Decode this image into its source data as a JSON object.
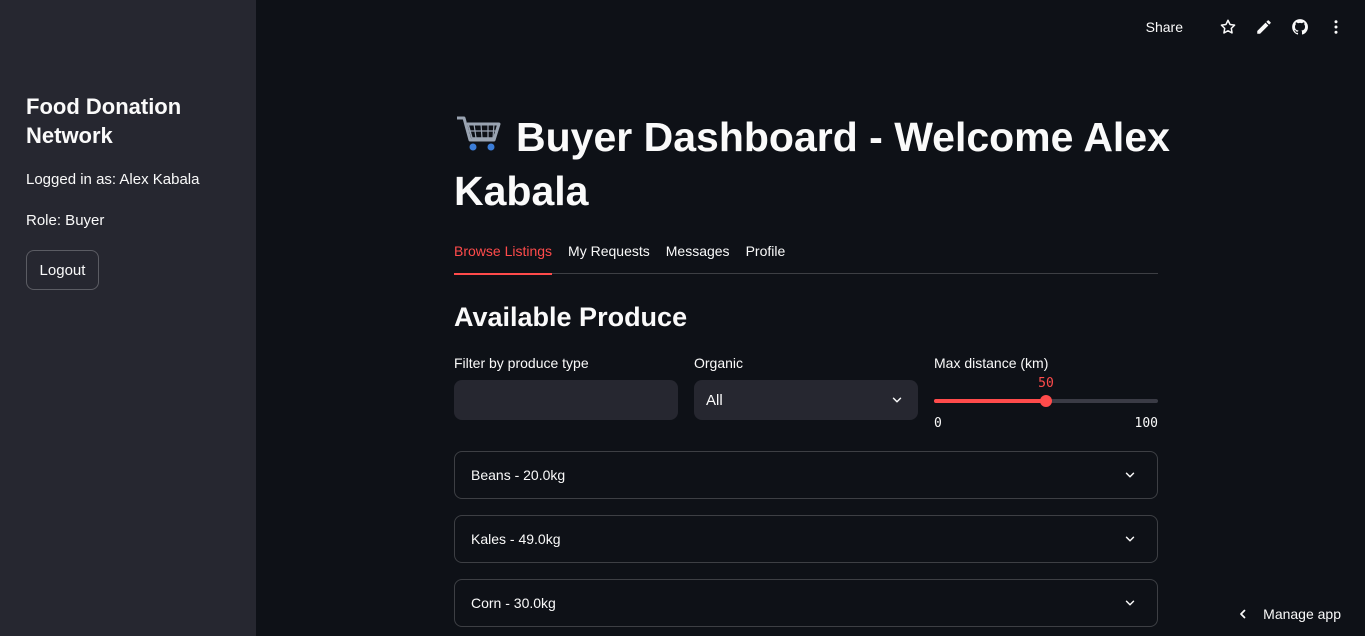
{
  "sidebar": {
    "title": "Food Donation Network",
    "logged_in": "Logged in as: Alex Kabala",
    "role": "Role: Buyer",
    "logout_label": "Logout"
  },
  "toolbar": {
    "share_label": "Share",
    "icons": [
      "star-icon",
      "pencil-icon",
      "github-icon",
      "more-vertical-icon"
    ]
  },
  "main": {
    "title_icon": "shopping-cart-icon",
    "title": "Buyer Dashboard - Welcome Alex Kabala",
    "tabs": [
      {
        "label": "Browse Listings",
        "active": true
      },
      {
        "label": "My Requests",
        "active": false
      },
      {
        "label": "Messages",
        "active": false
      },
      {
        "label": "Profile",
        "active": false
      }
    ],
    "section_title": "Available Produce",
    "filters": {
      "produce_label": "Filter by produce type",
      "produce_value": "",
      "organic_label": "Organic",
      "organic_value": "All",
      "distance_label": "Max distance (km)",
      "distance_value": "50",
      "distance_min": "0",
      "distance_max": "100",
      "distance_fraction": 0.5
    },
    "listings": [
      {
        "label": "Beans - 20.0kg"
      },
      {
        "label": "Kales - 49.0kg"
      },
      {
        "label": "Corn - 30.0kg"
      }
    ]
  },
  "footer": {
    "manage_app_label": "Manage app"
  },
  "colors": {
    "background": "#0e1117",
    "sidebar": "#262730",
    "accent": "#ff4b4b",
    "text": "#fafafa"
  }
}
